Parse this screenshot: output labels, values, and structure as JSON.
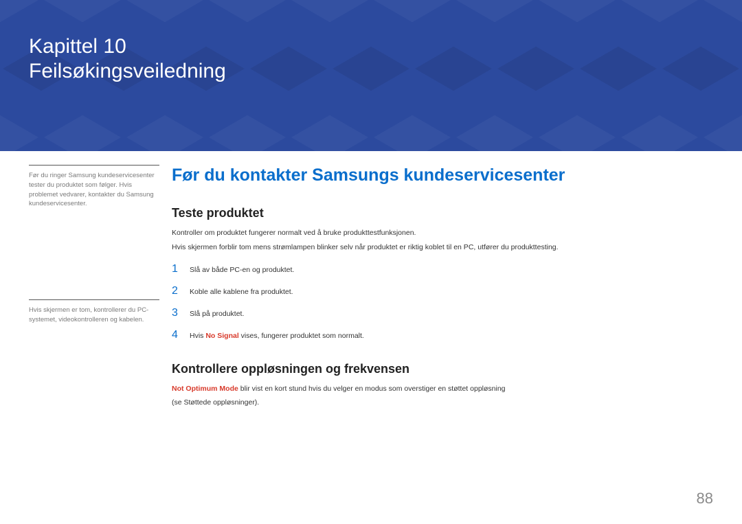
{
  "header": {
    "chapter_label": "Kapittel 10",
    "chapter_title": "Feilsøkingsveiledning"
  },
  "sidebar": {
    "note1": "Før du ringer Samsung kundeservicesenter tester du produktet som følger. Hvis problemet vedvarer, kontakter du Samsung kundeservicesenter.",
    "note2": "Hvis skjermen er tom, kontrollerer du PC-systemet, videokontrolleren og kabelen."
  },
  "main": {
    "h1": "Før du kontakter Samsungs kundeservicesenter",
    "section1": {
      "h2": "Teste produktet",
      "p1": "Kontroller om produktet fungerer normalt ved å bruke produkttestfunksjonen.",
      "p2": "Hvis skjermen forblir tom mens strømlampen blinker selv når produktet er riktig koblet til en PC, utfører du produkttesting.",
      "steps": [
        {
          "n": "1",
          "text": "Slå av både PC-en og produktet."
        },
        {
          "n": "2",
          "text": "Koble alle kablene fra produktet."
        },
        {
          "n": "3",
          "text": "Slå på produktet."
        },
        {
          "n": "4",
          "pre": "Hvis ",
          "bold": "No Signal",
          "post": " vises, fungerer produktet som normalt."
        }
      ]
    },
    "section2": {
      "h2": "Kontrollere oppløsningen og frekvensen",
      "p1_bold": "Not Optimum Mode",
      "p1_rest": " blir vist en kort stund hvis du velger en modus som overstiger en støttet oppløsning",
      "p2": "(se Støttede oppløsninger)."
    }
  },
  "page_number": "88"
}
